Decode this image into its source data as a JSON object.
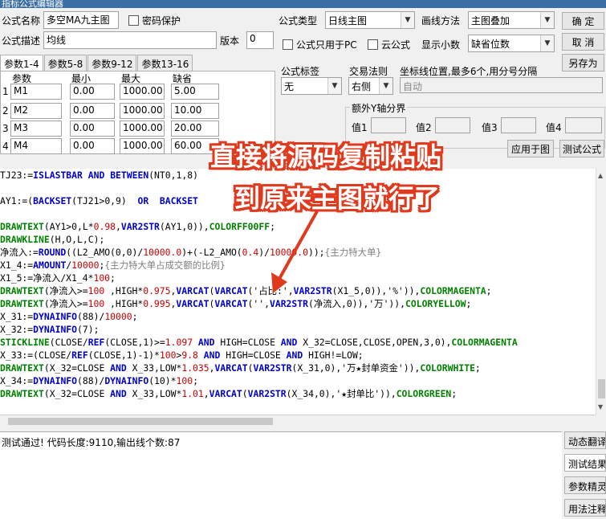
{
  "window": {
    "title": "指标公式编辑器"
  },
  "form": {
    "name_label": "公式名称",
    "name_value": "多空MA九主图",
    "password_label": "密码保护",
    "type_label": "公式类型",
    "type_value": "日线主图",
    "draw_label": "画线方法",
    "draw_value": "主图叠加",
    "desc_label": "公式描述",
    "desc_value": "均线",
    "version_label": "版本",
    "version_value": "0",
    "pc_only_label": "公式只用于PC",
    "cloud_label": "云公式",
    "decimals_label": "显示小数",
    "decimals_value": "缺省位数"
  },
  "buttons": {
    "ok": "确 定",
    "cancel": "取 消",
    "save_as": "另存为",
    "apply_chart": "应用于图",
    "test": "测试公式"
  },
  "tabs": [
    "参数1-4",
    "参数5-8",
    "参数9-12",
    "参数13-16"
  ],
  "params": {
    "headers": [
      "参数",
      "最小",
      "最大",
      "缺省"
    ],
    "rows": [
      {
        "idx": "1",
        "name": "M1",
        "min": "0.00",
        "max": "1000.00",
        "def": "5.00"
      },
      {
        "idx": "2",
        "name": "M2",
        "min": "0.00",
        "max": "1000.00",
        "def": "10.00"
      },
      {
        "idx": "3",
        "name": "M3",
        "min": "0.00",
        "max": "1000.00",
        "def": "20.00"
      },
      {
        "idx": "4",
        "name": "M4",
        "min": "0.00",
        "max": "1000.00",
        "def": "60.00"
      }
    ]
  },
  "options": {
    "tag_label": "公式标签",
    "tag_value": "无",
    "trade_label": "交易法则",
    "trade_value": "右侧",
    "coord_label": "坐标线位置,最多6个,用分号分隔",
    "coord_value": "自动",
    "yaxis_label": "额外Y轴分界",
    "val1": "值1",
    "val2": "值2",
    "val3": "值3",
    "val4": "值4"
  },
  "code_lines": [
    [
      {
        "t": "TJ23:=",
        "c": "str"
      },
      {
        "t": "ISLASTBAR",
        "c": "kw"
      },
      {
        "t": " AND ",
        "c": "kw"
      },
      {
        "t": "BETWEEN",
        "c": "kw"
      },
      {
        "t": "(NT0,1,8)",
        "c": "str"
      }
    ],
    [
      {
        "t": "",
        "c": "str"
      }
    ],
    [
      {
        "t": "AY1:=(",
        "c": "str"
      },
      {
        "t": "BACKSET",
        "c": "kw"
      },
      {
        "t": "(TJ21>0,9)  ",
        "c": "str"
      },
      {
        "t": "OR",
        "c": "kw"
      },
      {
        "t": "  BACKSET",
        "c": "kw"
      }
    ],
    [
      {
        "t": "",
        "c": "str"
      }
    ],
    [
      {
        "t": "DRAWTEXT",
        "c": "fn"
      },
      {
        "t": "(AY1>0,L*",
        "c": "str"
      },
      {
        "t": "0.98",
        "c": "num"
      },
      {
        "t": ",",
        "c": "str"
      },
      {
        "t": "VAR2STR",
        "c": "kw"
      },
      {
        "t": "(AY1,0)),",
        "c": "str"
      },
      {
        "t": "COLORFF00FF",
        "c": "fn"
      },
      {
        "t": ";",
        "c": "str"
      }
    ],
    [
      {
        "t": "DRAWKLINE",
        "c": "fn"
      },
      {
        "t": "(H,O,L,C);",
        "c": "str"
      }
    ],
    [
      {
        "t": "净流入:=",
        "c": "str"
      },
      {
        "t": "ROUND",
        "c": "kw"
      },
      {
        "t": "((L2_AMO(0,0)/",
        "c": "str"
      },
      {
        "t": "10000.0",
        "c": "num"
      },
      {
        "t": ")+(-L2_AMO(",
        "c": "str"
      },
      {
        "t": "0.4",
        "c": "num"
      },
      {
        "t": ")/",
        "c": "str"
      },
      {
        "t": "10000.0",
        "c": "num"
      },
      {
        "t": "));",
        "c": "str"
      },
      {
        "t": "{主力特大单}",
        "c": "cm"
      }
    ],
    [
      {
        "t": "X1_4:=",
        "c": "str"
      },
      {
        "t": "AMOUNT",
        "c": "kw"
      },
      {
        "t": "/",
        "c": "str"
      },
      {
        "t": "10000",
        "c": "num"
      },
      {
        "t": ";",
        "c": "str"
      },
      {
        "t": "{主力特大单占成交额的比例}",
        "c": "cm"
      }
    ],
    [
      {
        "t": "X1_5:=净流入/X1_4*",
        "c": "str"
      },
      {
        "t": "100",
        "c": "num"
      },
      {
        "t": ";",
        "c": "str"
      }
    ],
    [
      {
        "t": "DRAWTEXT",
        "c": "fn"
      },
      {
        "t": "(净流入>=",
        "c": "str"
      },
      {
        "t": "100",
        "c": "num"
      },
      {
        "t": " ,HIGH*",
        "c": "str"
      },
      {
        "t": "0.975",
        "c": "num"
      },
      {
        "t": ",",
        "c": "str"
      },
      {
        "t": "VARCAT",
        "c": "kw"
      },
      {
        "t": "(",
        "c": "str"
      },
      {
        "t": "VARCAT",
        "c": "kw"
      },
      {
        "t": "('占比:',",
        "c": "str"
      },
      {
        "t": "VAR2STR",
        "c": "kw"
      },
      {
        "t": "(X1_5,0)),'%')),",
        "c": "str"
      },
      {
        "t": "COLORMAGENTA",
        "c": "fn"
      },
      {
        "t": ";",
        "c": "str"
      }
    ],
    [
      {
        "t": "DRAWTEXT",
        "c": "fn"
      },
      {
        "t": "(净流入>=",
        "c": "str"
      },
      {
        "t": "100",
        "c": "num"
      },
      {
        "t": " ,HIGH*",
        "c": "str"
      },
      {
        "t": "0.995",
        "c": "num"
      },
      {
        "t": ",",
        "c": "str"
      },
      {
        "t": "VARCAT",
        "c": "kw"
      },
      {
        "t": "(",
        "c": "str"
      },
      {
        "t": "VARCAT",
        "c": "kw"
      },
      {
        "t": "('',",
        "c": "str"
      },
      {
        "t": "VAR2STR",
        "c": "kw"
      },
      {
        "t": "(净流入,0)),'万')),",
        "c": "str"
      },
      {
        "t": "COLORYELLOW",
        "c": "fn"
      },
      {
        "t": ";",
        "c": "str"
      }
    ],
    [
      {
        "t": "X_31:=",
        "c": "str"
      },
      {
        "t": "DYNAINFO",
        "c": "kw"
      },
      {
        "t": "(88)/",
        "c": "str"
      },
      {
        "t": "10000",
        "c": "num"
      },
      {
        "t": ";",
        "c": "str"
      }
    ],
    [
      {
        "t": "X_32:=",
        "c": "str"
      },
      {
        "t": "DYNAINFO",
        "c": "kw"
      },
      {
        "t": "(7);",
        "c": "str"
      }
    ],
    [
      {
        "t": "STICKLINE",
        "c": "fn"
      },
      {
        "t": "(CLOSE/",
        "c": "str"
      },
      {
        "t": "REF",
        "c": "kw"
      },
      {
        "t": "(CLOSE,1)>=",
        "c": "str"
      },
      {
        "t": "1.097",
        "c": "num"
      },
      {
        "t": " AND ",
        "c": "kw"
      },
      {
        "t": "HIGH=CLOSE ",
        "c": "str"
      },
      {
        "t": "AND",
        "c": "kw"
      },
      {
        "t": " X_32=CLOSE,CLOSE,OPEN,3,0),",
        "c": "str"
      },
      {
        "t": "COLORMAGENTA",
        "c": "fn"
      }
    ],
    [
      {
        "t": "X_33:=(CLOSE/",
        "c": "str"
      },
      {
        "t": "REF",
        "c": "kw"
      },
      {
        "t": "(CLOSE,1)-1)*",
        "c": "str"
      },
      {
        "t": "100",
        "c": "num"
      },
      {
        "t": ">",
        "c": "str"
      },
      {
        "t": "9.8",
        "c": "num"
      },
      {
        "t": " AND ",
        "c": "kw"
      },
      {
        "t": "HIGH=CLOSE ",
        "c": "str"
      },
      {
        "t": "AND",
        "c": "kw"
      },
      {
        "t": " HIGH!=LOW;",
        "c": "str"
      }
    ],
    [
      {
        "t": "DRAWTEXT",
        "c": "fn"
      },
      {
        "t": "(X_32=CLOSE ",
        "c": "str"
      },
      {
        "t": "AND",
        "c": "kw"
      },
      {
        "t": " X_33,LOW*",
        "c": "str"
      },
      {
        "t": "1.035",
        "c": "num"
      },
      {
        "t": ",",
        "c": "str"
      },
      {
        "t": "VARCAT",
        "c": "kw"
      },
      {
        "t": "(",
        "c": "str"
      },
      {
        "t": "VAR2STR",
        "c": "kw"
      },
      {
        "t": "(X_31,0),'万★封单资金')),",
        "c": "str"
      },
      {
        "t": "COLORWHITE",
        "c": "fn"
      },
      {
        "t": ";",
        "c": "str"
      }
    ],
    [
      {
        "t": "X_34:=",
        "c": "str"
      },
      {
        "t": "DYNAINFO",
        "c": "kw"
      },
      {
        "t": "(88)/",
        "c": "str"
      },
      {
        "t": "DYNAINFO",
        "c": "kw"
      },
      {
        "t": "(10)*",
        "c": "str"
      },
      {
        "t": "100",
        "c": "num"
      },
      {
        "t": ";",
        "c": "str"
      }
    ],
    [
      {
        "t": "DRAWTEXT",
        "c": "fn"
      },
      {
        "t": "(X_32=CLOSE ",
        "c": "str"
      },
      {
        "t": "AND",
        "c": "kw"
      },
      {
        "t": " X_33,LOW*",
        "c": "str"
      },
      {
        "t": "1.01",
        "c": "num"
      },
      {
        "t": ",",
        "c": "str"
      },
      {
        "t": "VARCAT",
        "c": "kw"
      },
      {
        "t": "(",
        "c": "str"
      },
      {
        "t": "VAR2STR",
        "c": "kw"
      },
      {
        "t": "(X_34,0),'★封单比')),",
        "c": "str"
      },
      {
        "t": "COLORGREEN",
        "c": "fn"
      },
      {
        "t": ";",
        "c": "str"
      }
    ]
  ],
  "overlay": {
    "line1": "直接将源码复制粘贴",
    "line2": "到原来主图就行了",
    "color": "#e03a1e"
  },
  "status": {
    "message": "测试通过! 代码长度:9110,输出线个数:87"
  },
  "side_tabs": [
    "动态翻译",
    "测试结果",
    "参数精灵",
    "用法注释"
  ]
}
